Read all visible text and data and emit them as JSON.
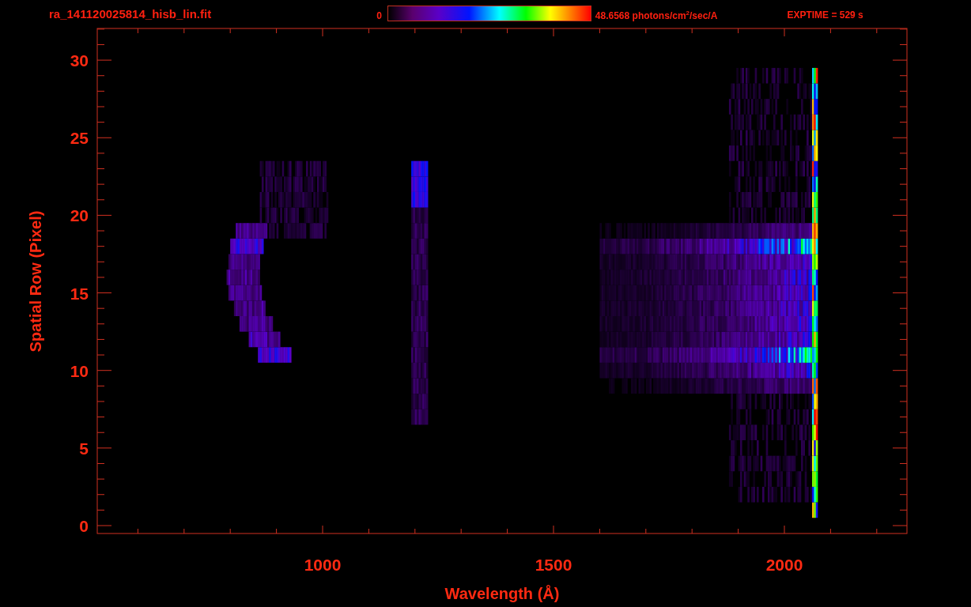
{
  "header": {
    "filename": "ra_141120025814_hisb_lin.fit",
    "colorbar_min": "0",
    "colorbar_max": "48.6568 photons/cm$^{2}$/sec/A",
    "exposure": "EXPTIME = 529 s"
  },
  "plot": {
    "xlabel": "Wavelength (Å)",
    "ylabel": "Spatial Row (Pixel)",
    "xticks": [
      "1000",
      "1500",
      "2000"
    ],
    "yticks": [
      "30",
      "25",
      "20",
      "15",
      "10",
      "5",
      "0"
    ]
  }
}
